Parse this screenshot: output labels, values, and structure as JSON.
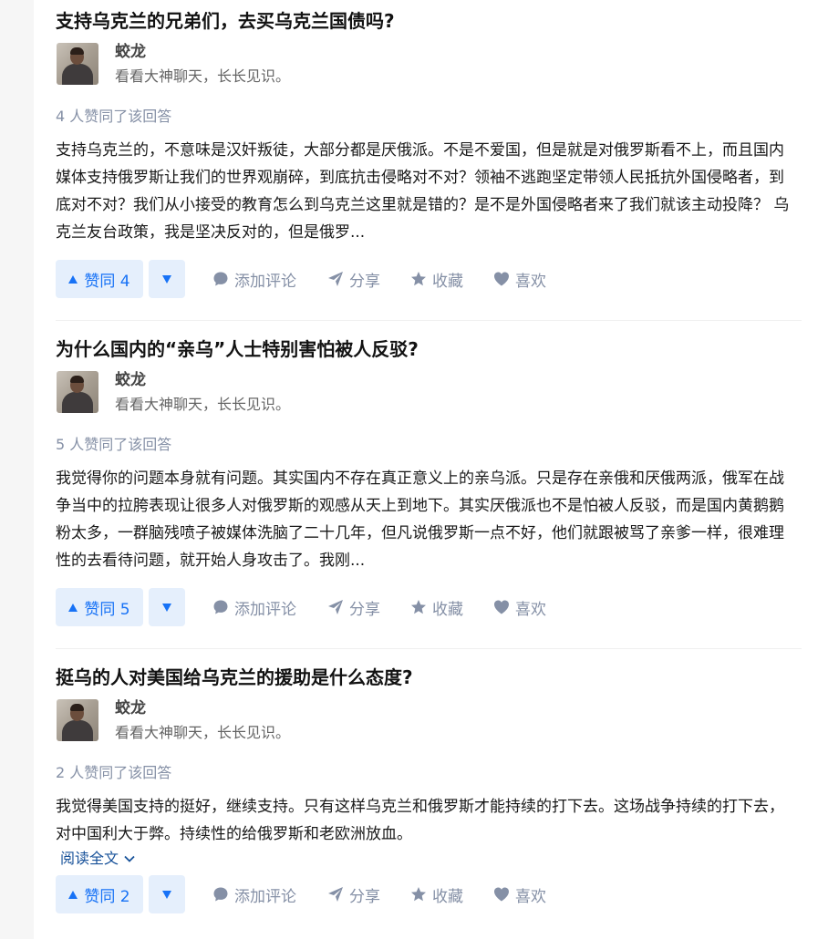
{
  "answers": [
    {
      "question": "支持乌克兰的兄弟们，去买乌克兰国债吗?",
      "author_name": "蛟龙",
      "author_bio": "看看大神聊天，长长见识。",
      "votes_text": "4 人赞同了该回答",
      "content": "支持乌克兰的，不意味是汉奸叛徒，大部分都是厌俄派。不是不爱国，但是就是对俄罗斯看不上，而且国内媒体支持俄罗斯让我们的世界观崩碎，到底抗击侵略对不对？领袖不逃跑坚定带领人民抵抗外国侵略者，到底对不对？我们从小接受的教育怎么到乌克兰这里就是错的？是不是外国侵略者来了我们就该主动投降？ 乌克兰友台政策，我是坚决反对的，但是俄罗...",
      "vote_label": "赞同 4",
      "read_more": ""
    },
    {
      "question": "为什么国内的“亲乌”人士特别害怕被人反驳?",
      "author_name": "蛟龙",
      "author_bio": "看看大神聊天，长长见识。",
      "votes_text": "5 人赞同了该回答",
      "content": "我觉得你的问题本身就有问题。其实国内不存在真正意义上的亲乌派。只是存在亲俄和厌俄两派，俄军在战争当中的拉胯表现让很多人对俄罗斯的观感从天上到地下。其实厌俄派也不是怕被人反驳，而是国内黄鹅鹅粉太多，一群脑残喷子被媒体洗脑了二十几年，但凡说俄罗斯一点不好，他们就跟被骂了亲爹一样，很难理性的去看待问题，就开始人身攻击了。我刚...",
      "vote_label": "赞同 5",
      "read_more": ""
    },
    {
      "question": "挺乌的人对美国给乌克兰的援助是什么态度?",
      "author_name": "蛟龙",
      "author_bio": "看看大神聊天，长长见识。",
      "votes_text": "2 人赞同了该回答",
      "content": "我觉得美国支持的挺好，继续支持。只有这样乌克兰和俄罗斯才能持续的打下去。这场战争持续的打下去，对中国利大于弊。持续性的给俄罗斯和老欧洲放血。",
      "vote_label": "赞同 2",
      "read_more": "阅读全文"
    }
  ],
  "actions": {
    "comment": "添加评论",
    "share": "分享",
    "favorite": "收藏",
    "like": "喜欢"
  },
  "icons": {
    "vote_up": "triangle-up-icon",
    "vote_down": "triangle-down-icon",
    "comment": "comment-bubble-icon",
    "share": "paper-plane-icon",
    "favorite": "star-icon",
    "like": "heart-icon",
    "read_more": "chevron-down-icon"
  },
  "colors": {
    "title": "#121212",
    "meta": "#8590a6",
    "vote_bg": "#e5effc",
    "vote_text": "#1772f6",
    "link": "#175199"
  }
}
